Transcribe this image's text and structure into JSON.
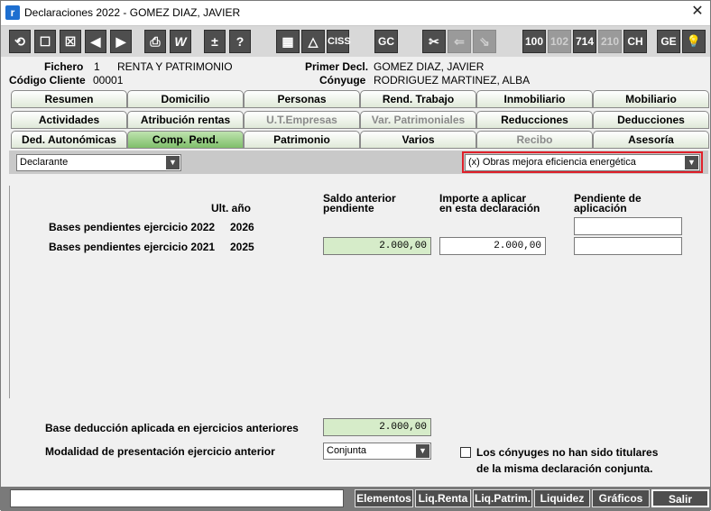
{
  "window": {
    "title": "Declaraciones 2022 - GOMEZ  DIAZ, JAVIER",
    "app_icon_letter": "r",
    "close_glyph": "✕"
  },
  "toolbar": {
    "buttons": [
      {
        "name": "refresh-icon",
        "glyph": "⟲"
      },
      {
        "name": "new-icon",
        "glyph": "☐"
      },
      {
        "name": "delete-icon",
        "glyph": "☒"
      },
      {
        "name": "prev-icon",
        "glyph": "◀"
      },
      {
        "name": "next-icon",
        "glyph": "▶"
      },
      {
        "name": "print-icon",
        "glyph": "⎙"
      },
      {
        "name": "word-icon",
        "glyph": "W"
      },
      {
        "name": "plus-minus-icon",
        "glyph": "±"
      },
      {
        "name": "help-icon",
        "glyph": "?"
      },
      {
        "name": "calculator-icon",
        "glyph": "▦"
      },
      {
        "name": "warning-icon",
        "glyph": "△"
      },
      {
        "name": "ciss-button",
        "glyph": "CISS"
      },
      {
        "name": "gc-button",
        "glyph": "GC"
      },
      {
        "name": "cut-icon",
        "glyph": "✂"
      },
      {
        "name": "link-icon",
        "glyph": "⇐"
      },
      {
        "name": "unlink-icon",
        "glyph": "⇘"
      },
      {
        "name": "model-100-button",
        "glyph": "100"
      },
      {
        "name": "model-102-button",
        "glyph": "102"
      },
      {
        "name": "model-714-button",
        "glyph": "714"
      },
      {
        "name": "model-210-button",
        "glyph": "210"
      },
      {
        "name": "ch-button",
        "glyph": "CH"
      },
      {
        "name": "ge-button",
        "glyph": "GE"
      },
      {
        "name": "bulb-icon",
        "glyph": "💡"
      }
    ]
  },
  "header": {
    "fichero_label": "Fichero",
    "fichero_number": "1",
    "fichero_value": "RENTA Y PATRIMONIO",
    "codigo_label": "Código Cliente",
    "codigo_value": "00001",
    "primer_decl_label": "Primer Decl.",
    "primer_decl_value": "GOMEZ  DIAZ, JAVIER",
    "conyuge_label": "Cónyuge",
    "conyuge_value": "RODRIGUEZ MARTINEZ, ALBA"
  },
  "tabs": {
    "row1": [
      "Resumen",
      "Domicilio",
      "Personas",
      "Rend. Trabajo",
      "Inmobiliario",
      "Mobiliario"
    ],
    "row2": [
      "Actividades",
      "Atribución rentas",
      "U.T.Empresas",
      "Var. Patrimoniales",
      "Reducciones",
      "Deducciones"
    ],
    "row3": [
      "Ded. Autonómicas",
      "Comp. Pend.",
      "Patrimonio",
      "Varios",
      "Recibo",
      "Asesoría"
    ]
  },
  "selectors": {
    "declarante": "Declarante",
    "concepto": "(x) Obras mejora eficiencia energética"
  },
  "table": {
    "col_ult": "Ult. año",
    "col_saldo_1": "Saldo anterior",
    "col_saldo_2": "pendiente",
    "col_importe_1": "Importe a aplicar",
    "col_importe_2": "en esta declaración",
    "col_pend_1": "Pendiente de",
    "col_pend_2": "aplicación",
    "rows": [
      {
        "label": "Bases pendientes ejercicio 2022",
        "year": "2026",
        "saldo": "",
        "importe": "",
        "pendiente": ""
      },
      {
        "label": "Bases pendientes ejercicio 2021",
        "year": "2025",
        "saldo": "2.000,00",
        "importe": "2.000,00",
        "pendiente": ""
      }
    ]
  },
  "bottom": {
    "base_label": "Base deducción aplicada en ejercicios anteriores",
    "base_value": "2.000,00",
    "modalidad_label": "Modalidad de presentación ejercicio anterior",
    "modalidad_value": "Conjunta",
    "checkbox_text_1": "Los cónyuges no han sido titulares",
    "checkbox_text_2": "de la misma declaración conjunta."
  },
  "footer": {
    "input_value": "",
    "elementos": "Elementos",
    "liq_renta": "Liq.Renta",
    "liq_patrim": "Liq.Patrim.",
    "liquidez": "Liquidez",
    "graficos": "Gráficos",
    "salir": "Salir"
  }
}
